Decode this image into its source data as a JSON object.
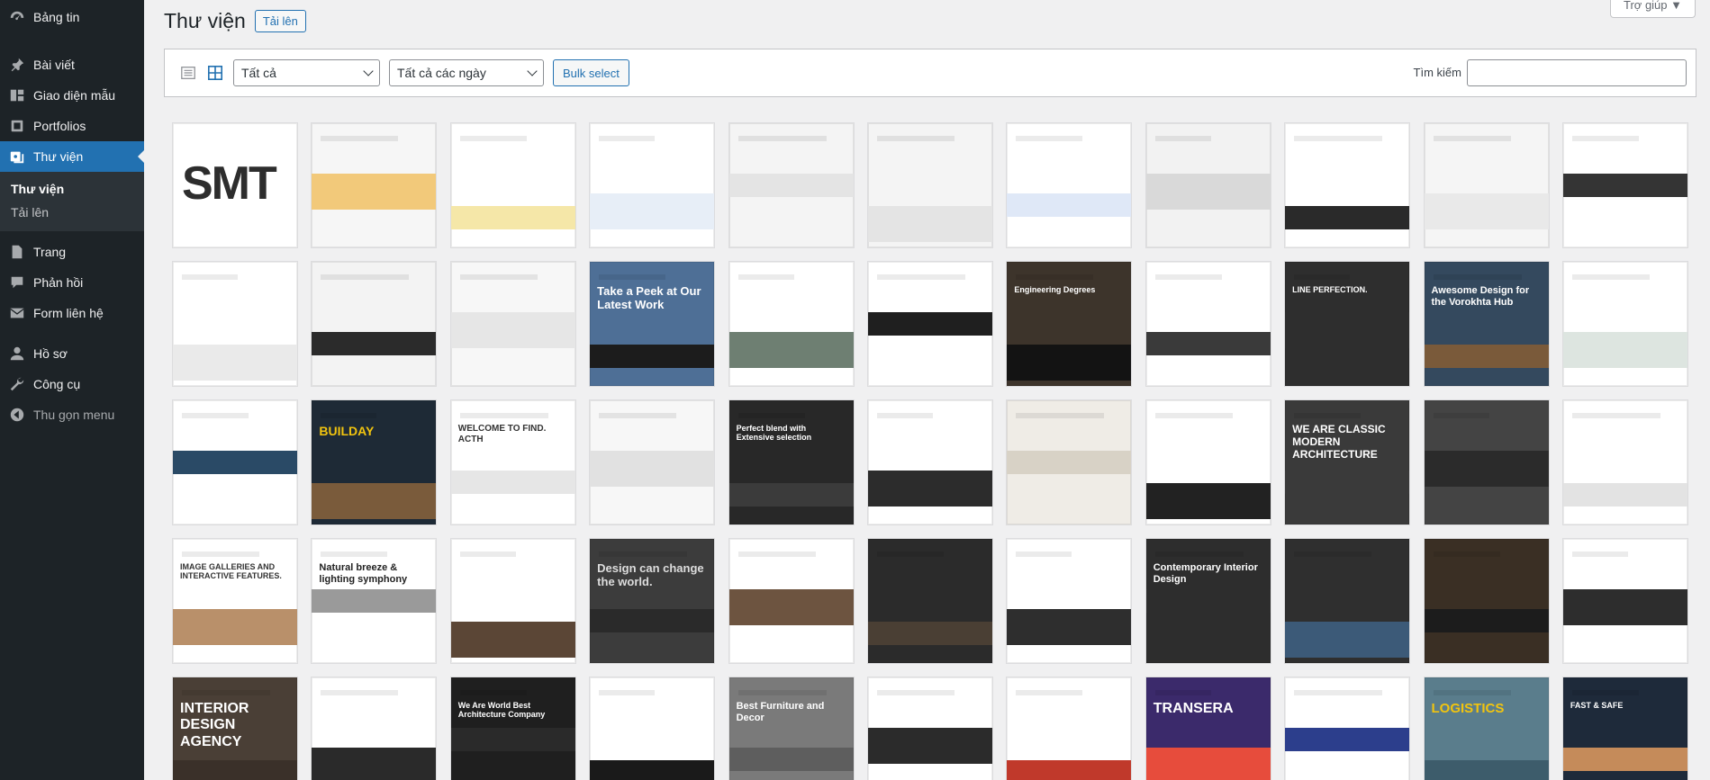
{
  "sidebar": {
    "items": [
      {
        "label": "Bảng tin",
        "icon": "dashboard-icon"
      },
      {
        "label": "Bài viết",
        "icon": "pin-icon"
      },
      {
        "label": "Giao diện mẫu",
        "icon": "template-icon"
      },
      {
        "label": "Portfolios",
        "icon": "portfolio-icon"
      },
      {
        "label": "Thư viện",
        "icon": "media-icon"
      },
      {
        "label": "Trang",
        "icon": "page-icon"
      },
      {
        "label": "Phản hồi",
        "icon": "comment-icon"
      },
      {
        "label": "Form liên hệ",
        "icon": "mail-icon"
      },
      {
        "label": "Hồ sơ",
        "icon": "user-icon"
      },
      {
        "label": "Công cụ",
        "icon": "wrench-icon"
      }
    ],
    "submenu": {
      "current": "Thư viện",
      "other": "Tải lên"
    },
    "collapse_label": "Thu gọn menu"
  },
  "header": {
    "title": "Thư viện",
    "add_new": "Tải lên",
    "help": "Trợ giúp ▼"
  },
  "toolbar": {
    "filter_type": "Tất cả",
    "filter_date": "Tất cả các ngày",
    "bulk": "Bulk select",
    "search_label": "Tìm kiếm",
    "search_value": ""
  },
  "thumbnails": [
    {
      "bg": "#ffffff",
      "text": "SMT",
      "tc": "#2d2d2d",
      "size": 52,
      "band": ""
    },
    {
      "bg": "#f6f6f6",
      "text": "",
      "tc": "#333",
      "size": 10,
      "band": "#f2c97a"
    },
    {
      "bg": "#ffffff",
      "text": "",
      "tc": "#333",
      "size": 10,
      "band": "#f5e7a8"
    },
    {
      "bg": "#ffffff",
      "text": "",
      "tc": "#333",
      "size": 10,
      "band": "#e7eef7"
    },
    {
      "bg": "#f4f4f4",
      "text": "",
      "tc": "#333",
      "size": 10,
      "band": "#e4e4e4"
    },
    {
      "bg": "#f4f4f4",
      "text": "",
      "tc": "#333",
      "size": 10,
      "band": "#e4e4e4"
    },
    {
      "bg": "#ffffff",
      "text": "",
      "tc": "#333",
      "size": 10,
      "band": "#dfe8f7"
    },
    {
      "bg": "#f2f2f2",
      "text": "",
      "tc": "#333",
      "size": 10,
      "band": "#d9d9d9"
    },
    {
      "bg": "#ffffff",
      "text": "",
      "tc": "#333",
      "size": 10,
      "band": "#2a2a2a"
    },
    {
      "bg": "#f5f5f5",
      "text": "",
      "tc": "#333",
      "size": 10,
      "band": "#e9e9e9"
    },
    {
      "bg": "#ffffff",
      "text": "",
      "tc": "#333",
      "size": 10,
      "band": "#343434"
    },
    {
      "bg": "#ffffff",
      "text": "",
      "tc": "#333",
      "size": 10,
      "band": "#eaeaea"
    },
    {
      "bg": "#f3f3f3",
      "text": "",
      "tc": "#333",
      "size": 10,
      "band": "#2b2b2b"
    },
    {
      "bg": "#f7f7f7",
      "text": "",
      "tc": "#333",
      "size": 10,
      "band": "#e6e6e6"
    },
    {
      "bg": "#4e6f96",
      "text": "Take a Peek at Our Latest Work",
      "tc": "#ffffff",
      "size": 13,
      "band": "#1c1c1c"
    },
    {
      "bg": "#ffffff",
      "text": "",
      "tc": "#333",
      "size": 10,
      "band": "#6e7f72"
    },
    {
      "bg": "#ffffff",
      "text": "",
      "tc": "#333",
      "size": 10,
      "band": "#1f1f1f"
    },
    {
      "bg": "#3d342b",
      "text": "Engineering Degrees",
      "tc": "#ffffff",
      "size": 9,
      "band": "#131313"
    },
    {
      "bg": "#ffffff",
      "text": "",
      "tc": "#333",
      "size": 10,
      "band": "#3a3a3a"
    },
    {
      "bg": "#2e2e2e",
      "text": "LINE PERFECTION.",
      "tc": "#ffffff",
      "size": 9,
      "band": "#2e2e2e"
    },
    {
      "bg": "#34495e",
      "text": "Awesome Design for the Vorokhta Hub",
      "tc": "#ffffff",
      "size": 11,
      "band": "#7a5a3a"
    },
    {
      "bg": "#ffffff",
      "text": "",
      "tc": "#333",
      "size": 10,
      "band": "#dde5e0"
    },
    {
      "bg": "#ffffff",
      "text": "",
      "tc": "#333",
      "size": 10,
      "band": "#2a4a66"
    },
    {
      "bg": "#1e2a36",
      "text": "BUILDAY",
      "tc": "#f1c40f",
      "size": 14,
      "band": "#7a5b3b"
    },
    {
      "bg": "#ffffff",
      "text": "WELCOME TO FIND. ACTH",
      "tc": "#333333",
      "size": 10,
      "band": "#e6e6e6"
    },
    {
      "bg": "#f7f7f7",
      "text": "",
      "tc": "#333",
      "size": 10,
      "band": "#e1e1e1"
    },
    {
      "bg": "#282828",
      "text": "Perfect blend with Extensive selection",
      "tc": "#ffffff",
      "size": 9,
      "band": "#3b3b3b"
    },
    {
      "bg": "#ffffff",
      "text": "",
      "tc": "#333",
      "size": 10,
      "band": "#2c2c2c"
    },
    {
      "bg": "#efece6",
      "text": "",
      "tc": "#333",
      "size": 10,
      "band": "#d8d2c6"
    },
    {
      "bg": "#ffffff",
      "text": "",
      "tc": "#333",
      "size": 10,
      "band": "#222222"
    },
    {
      "bg": "#3a3a3a",
      "text": "WE ARE CLASSIC MODERN ARCHITECTURE",
      "tc": "#ffffff",
      "size": 12,
      "band": "#3a3a3a"
    },
    {
      "bg": "#444444",
      "text": "",
      "tc": "#333",
      "size": 10,
      "band": "#2b2b2b"
    },
    {
      "bg": "#ffffff",
      "text": "",
      "tc": "#333",
      "size": 10,
      "band": "#e3e3e3"
    },
    {
      "bg": "#ffffff",
      "text": "IMAGE GALLERIES AND INTERACTIVE FEATURES.",
      "tc": "#333333",
      "size": 9,
      "band": "#b9906a"
    },
    {
      "bg": "#ffffff",
      "text": "Natural breeze & lighting symphony",
      "tc": "#222222",
      "size": 11,
      "band": "#9a9a9a"
    },
    {
      "bg": "#ffffff",
      "text": "",
      "tc": "#333",
      "size": 10,
      "band": "#5b4636"
    },
    {
      "bg": "#3c3c3c",
      "text": "Design can change the world.",
      "tc": "#dddddd",
      "size": 13,
      "band": "#2a2a2a"
    },
    {
      "bg": "#ffffff",
      "text": "",
      "tc": "#333",
      "size": 10,
      "band": "#6d5440"
    },
    {
      "bg": "#2b2b2b",
      "text": "",
      "tc": "#333",
      "size": 10,
      "band": "#4a3f34"
    },
    {
      "bg": "#ffffff",
      "text": "",
      "tc": "#333",
      "size": 10,
      "band": "#2e2e2e"
    },
    {
      "bg": "#2d2d2d",
      "text": "Contemporary Interior Design",
      "tc": "#ffffff",
      "size": 11,
      "band": "#2d2d2d"
    },
    {
      "bg": "#2f2f2f",
      "text": "",
      "tc": "#333",
      "size": 10,
      "band": "#3c5a78"
    },
    {
      "bg": "#3a2f24",
      "text": "",
      "tc": "#333",
      "size": 10,
      "band": "#1c1c1c"
    },
    {
      "bg": "#ffffff",
      "text": "",
      "tc": "#333",
      "size": 10,
      "band": "#2d2d2d"
    },
    {
      "bg": "#4a3f36",
      "text": "INTERIOR DESIGN AGENCY",
      "tc": "#ffffff",
      "size": 16,
      "band": "#3a3029"
    },
    {
      "bg": "#ffffff",
      "text": "",
      "tc": "#333",
      "size": 10,
      "band": "#2a2a2a"
    },
    {
      "bg": "#1f1f1f",
      "text": "We Are World Best Architecture Company",
      "tc": "#ffffff",
      "size": 9,
      "band": "#2a2a2a"
    },
    {
      "bg": "#ffffff",
      "text": "",
      "tc": "#333",
      "size": 10,
      "band": "#1a1a1a"
    },
    {
      "bg": "#7a7a7a",
      "text": "Best Furniture and Decor",
      "tc": "#ffffff",
      "size": 11,
      "band": "#5e5e5e"
    },
    {
      "bg": "#ffffff",
      "text": "",
      "tc": "#333",
      "size": 10,
      "band": "#2b2b2b"
    },
    {
      "bg": "#ffffff",
      "text": "",
      "tc": "#333",
      "size": 10,
      "band": "#c0392b"
    },
    {
      "bg": "#3b2a6b",
      "text": "TRANSERA",
      "tc": "#ffffff",
      "size": 16,
      "band": "#e74c3c"
    },
    {
      "bg": "#ffffff",
      "text": "",
      "tc": "#333",
      "size": 10,
      "band": "#2c3e8c"
    },
    {
      "bg": "#5a7d8c",
      "text": "LOGISTICS",
      "tc": "#f1c40f",
      "size": 15,
      "band": "#3d5c6b"
    },
    {
      "bg": "#1e2a3a",
      "text": "FAST & SAFE",
      "tc": "#ffffff",
      "size": 9,
      "band": "#c58b5a"
    }
  ]
}
